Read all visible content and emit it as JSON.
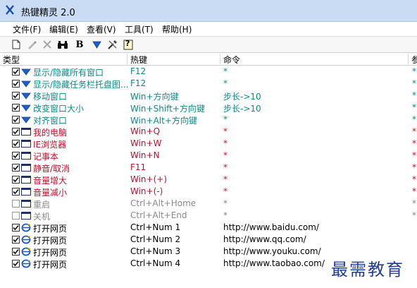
{
  "window": {
    "title": "热键精灵 2.0"
  },
  "menu": [
    {
      "label": "文件(F)"
    },
    {
      "label": "编辑(E)"
    },
    {
      "label": "查看(V)"
    },
    {
      "label": "工具(T)"
    },
    {
      "label": "帮助(H)"
    }
  ],
  "toolbar": {
    "buttons": [
      "new-icon",
      "edit-icon",
      "delete-icon",
      "binoculars-icon",
      "bold-b-icon",
      "down-arrow-icon",
      "tools-icon",
      "help-icon"
    ],
    "bold_label": "B",
    "help_label": "?"
  },
  "columns": {
    "type": "类型",
    "hotkey": "热键",
    "command": "命令",
    "extra": "参"
  },
  "rows": [
    {
      "name": "显示/隐藏所有窗口",
      "key": "F12",
      "cmd": "*",
      "extra": "*",
      "checked": true,
      "icon": "blue-down-arrow-icon",
      "color": "#0e8a8a"
    },
    {
      "name": "显示/隐藏任务栏托盘图...",
      "key": "F12",
      "cmd": "*",
      "extra": "*",
      "checked": true,
      "icon": "blue-down-arrow-icon",
      "color": "#0e8a8a"
    },
    {
      "name": "移动窗口",
      "key": "Win+方向键",
      "cmd": "步长->10",
      "extra": "*",
      "checked": true,
      "icon": "blue-down-arrow-icon",
      "color": "#0e8a8a"
    },
    {
      "name": "改变窗口大小",
      "key": "Win+Shift+方向键",
      "cmd": "步长->10",
      "extra": "*",
      "checked": true,
      "icon": "blue-down-arrow-icon",
      "color": "#0e8a8a"
    },
    {
      "name": "对齐窗口",
      "key": "Win+Alt+方向键",
      "cmd": "*",
      "extra": "*",
      "checked": true,
      "icon": "blue-down-arrow-icon",
      "color": "#0e8a8a"
    },
    {
      "name": "我的电脑",
      "key": "Win+Q",
      "cmd": "*",
      "extra": "*",
      "checked": true,
      "icon": "window-icon",
      "color": "#c0102a"
    },
    {
      "name": "IE浏览器",
      "key": "Win+W",
      "cmd": "*",
      "extra": "*",
      "checked": true,
      "icon": "window-icon",
      "color": "#c0102a"
    },
    {
      "name": "记事本",
      "key": "Win+N",
      "cmd": "*",
      "extra": "*",
      "checked": true,
      "icon": "window-icon",
      "color": "#c0102a"
    },
    {
      "name": "静音/取消",
      "key": "F11",
      "cmd": "*",
      "extra": "*",
      "checked": true,
      "icon": "window-icon",
      "color": "#c0102a"
    },
    {
      "name": "音量增大",
      "key": "Win+(+)",
      "cmd": "*",
      "extra": "*",
      "checked": true,
      "icon": "window-icon",
      "color": "#c0102a"
    },
    {
      "name": "音量减小",
      "key": "Win+(-)",
      "cmd": "*",
      "extra": "*",
      "checked": true,
      "icon": "window-icon",
      "color": "#c0102a"
    },
    {
      "name": "重启",
      "key": "Ctrl+Alt+Home",
      "cmd": "*",
      "extra": "*",
      "checked": false,
      "icon": "window-icon",
      "color": "#8a8a8a"
    },
    {
      "name": "关机",
      "key": "Ctrl+Alt+End",
      "cmd": "*",
      "extra": "*",
      "checked": false,
      "icon": "window-icon",
      "color": "#8a8a8a"
    },
    {
      "name": "打开网页",
      "key": "Ctrl+Num 1",
      "cmd": "http://www.baidu.com/",
      "extra": "",
      "checked": true,
      "icon": "ie-icon",
      "color": "#000000"
    },
    {
      "name": "打开网页",
      "key": "Ctrl+Num 2",
      "cmd": "http://www.qq.com/",
      "extra": "",
      "checked": true,
      "icon": "ie-icon",
      "color": "#000000"
    },
    {
      "name": "打开网页",
      "key": "Ctrl+Num 3",
      "cmd": "http://www.youku.com/",
      "extra": "",
      "checked": true,
      "icon": "ie-icon",
      "color": "#000000"
    },
    {
      "name": "打开网页",
      "key": "Ctrl+Num 4",
      "cmd": "http://www.taobao.com/",
      "extra": "",
      "checked": true,
      "icon": "ie-icon",
      "color": "#000000"
    }
  ],
  "watermark": "最需教育"
}
